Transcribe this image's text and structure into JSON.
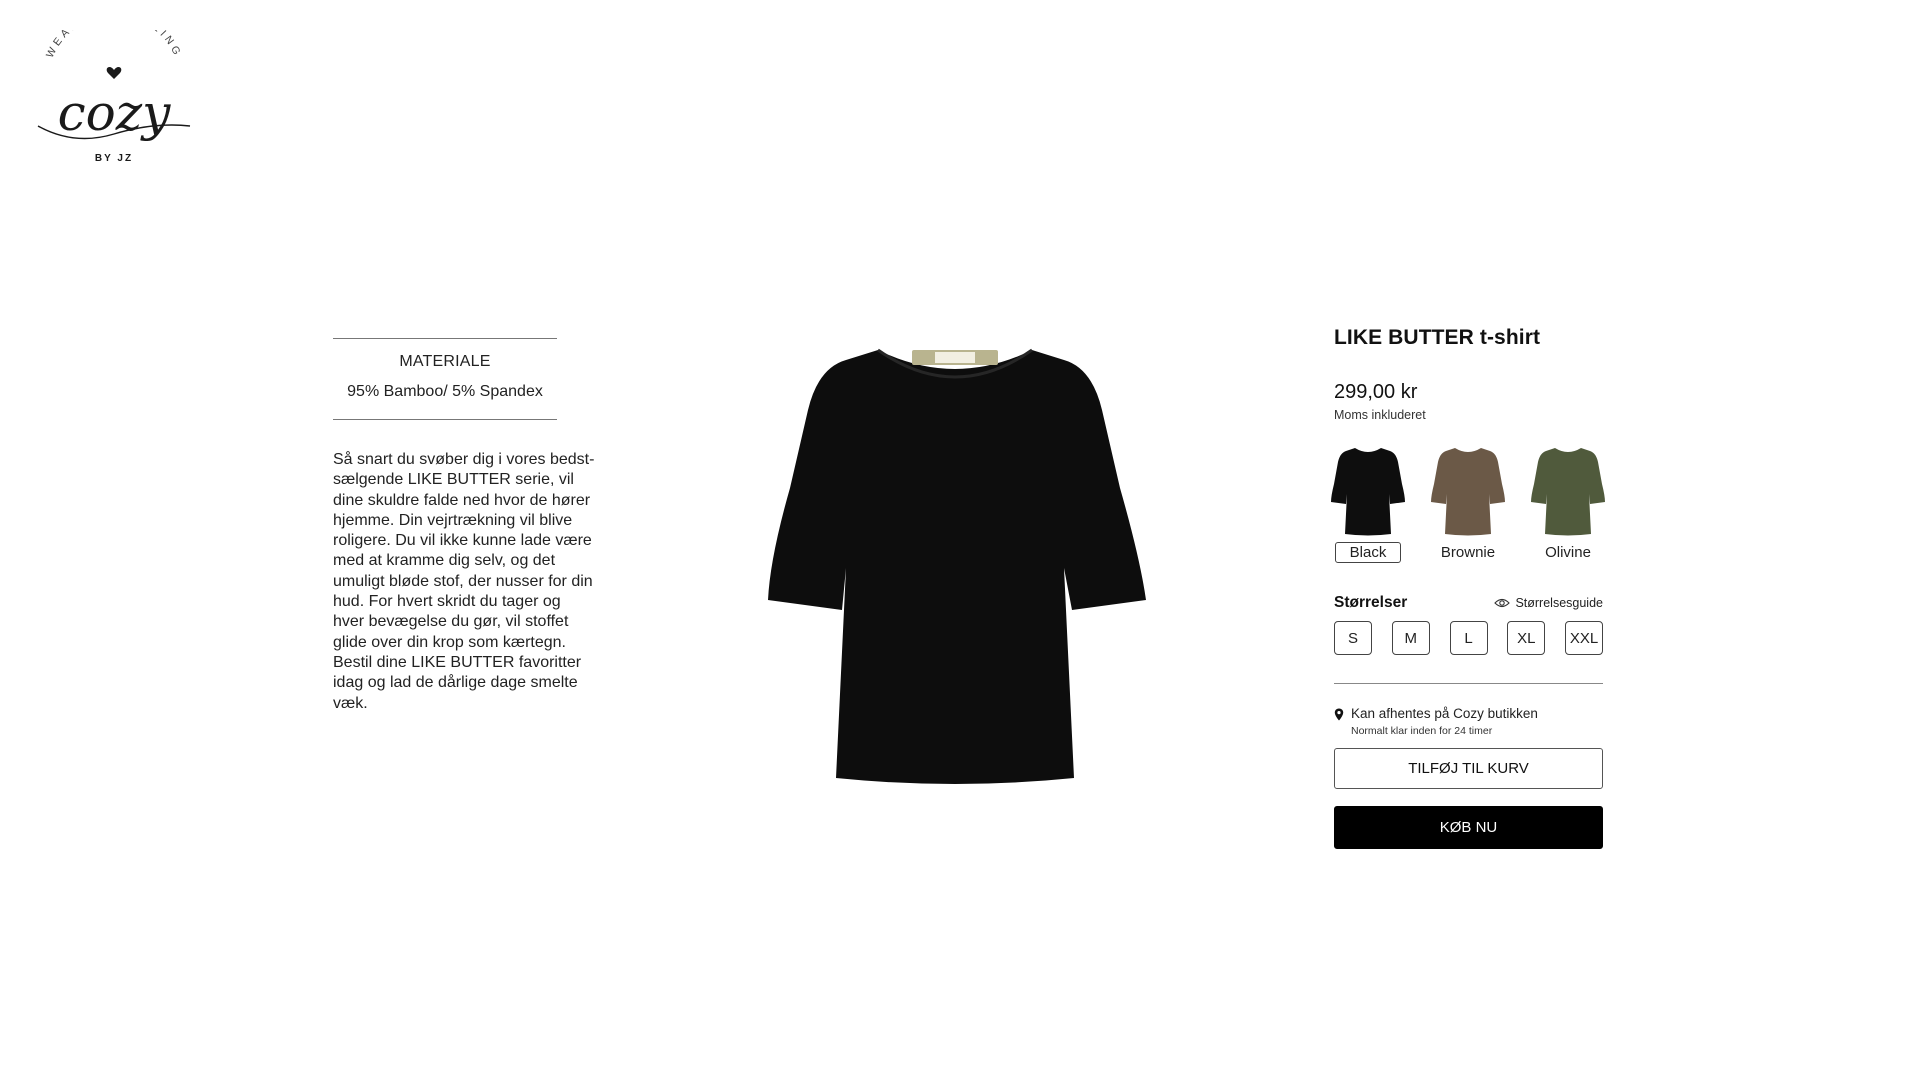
{
  "header": {
    "logo": {
      "tagline": "WEAR THE FEELING",
      "brand": "cozy",
      "byline": "BY JZ"
    }
  },
  "product_info": {
    "material_title": "MATERIALE",
    "material_value": "95% Bamboo/ 5% Spandex",
    "description": "Så snart du svøber dig i vores bedst-sælgende LIKE BUTTER serie, vil dine skuldre falde ned hvor de hører hjemme. Din vejrtrækning vil blive roligere. Du vil ikke kunne lade være med at kramme dig selv, og det umuligt bløde stof, der nusser for din hud. For hvert skridt du tager og hver bevægelse du gør, vil stoffet glide over din krop som kærtegn. Bestil dine LIKE BUTTER favoritter idag og lad de dårlige dage smelte væk.",
    "image_color": "#0d0d0d"
  },
  "purchase": {
    "title": "LIKE BUTTER t-shirt",
    "price": "299,00 kr",
    "vat_note": "Moms inkluderet",
    "colors": [
      {
        "label": "Black",
        "hex": "#0e0e0e",
        "selected": true
      },
      {
        "label": "Brownie",
        "hex": "#6b5947",
        "selected": false
      },
      {
        "label": "Olivine",
        "hex": "#505a3c",
        "selected": false
      }
    ],
    "sizes_title": "Størrelser",
    "size_guide_label": "Størrelsesguide",
    "size_guide_icon": "eye-icon",
    "sizes": [
      "S",
      "M",
      "L",
      "XL",
      "XXL"
    ],
    "pickup_icon": "location-pin-icon",
    "pickup_title": "Kan afhentes på Cozy butikken",
    "pickup_note": "Normalt klar inden for 24 timer",
    "add_to_cart_label": "TILFØJ TIL KURV",
    "buy_now_label": "KØB NU"
  }
}
